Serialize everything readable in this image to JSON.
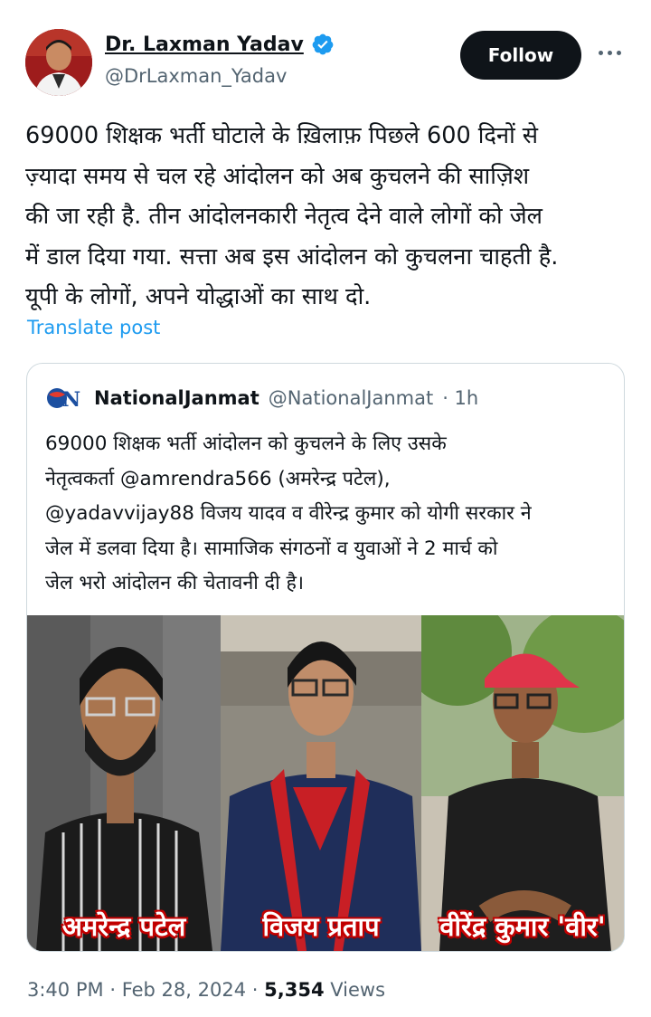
{
  "author": {
    "display_name": "Dr. Laxman Yadav",
    "handle": "@DrLaxman_Yadav",
    "verified": true
  },
  "follow_label": "Follow",
  "post_text": "69000 शिक्षक भर्ती घोटाले के ख़िलाफ़ पिछले 600 दिनों से\nज़्यादा समय से चल रहे आंदोलन को अब कुचलने की साज़िश\nकी जा रही है. तीन आंदोलनकारी नेतृत्व देने वाले लोगों को जेल\nमें डाल दिया गया. सत्ता अब इस आंदोलन को कुचलना चाहती है.\nयूपी के लोगों, अपने योद्धाओं का साथ दो.",
  "translate_label": "Translate post",
  "quote": {
    "name": "NationalJanmat",
    "handle": "@NationalJanmat",
    "time": "· 1h",
    "text": "69000 शिक्षक भर्ती आंदोलन को कुचलने के लिए उसके\nनेतृत्वकर्ता @amrendra566  (अमरेन्द्र पटेल),\n@yadavvijay88 विजय यादव व वीरेन्द्र कुमार को योगी सरकार ने\nजेल में डलवा दिया है। सामाजिक संगठनों व युवाओं ने 2 मार्च को\nजेल भरो आंदोलन की चेतावनी दी है।",
    "image_captions": [
      "अमरेन्द्र पटेल",
      "विजय प्रताप",
      "वीरेंद्र कुमार 'वीर'"
    ]
  },
  "meta": {
    "time": "3:40 PM",
    "date": "Feb 28, 2024",
    "views_count": "5,354",
    "views_label": "Views",
    "sep": "·"
  },
  "colors": {
    "link": "#1d9bf0",
    "text": "#0f1419",
    "secondary": "#536471",
    "caption_outline": "#c40000"
  }
}
